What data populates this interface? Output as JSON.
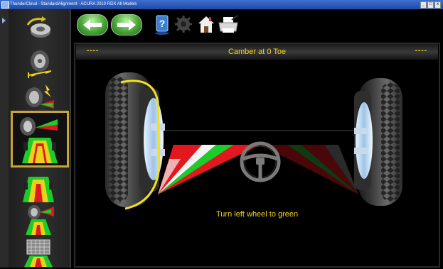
{
  "window": {
    "title": "ThunderCloud - StandardAlignment - ACURA 2010 RDX All Models",
    "buttons": [
      "_",
      "□",
      "x"
    ]
  },
  "toolbar": {
    "back_label": "back-arrow-icon",
    "forward_label": "forward-arrow-icon",
    "icons": [
      "help-book-icon",
      "settings-gear-icon",
      "home-icon",
      "print-icon"
    ]
  },
  "sidebar": {
    "items": [
      {
        "icon": "rotate-adapter-icon"
      },
      {
        "icon": "wheel-measure-icon"
      },
      {
        "icon": "camber-lightning-icon"
      },
      {
        "icon": "camber-at-zero-toe-icon",
        "selected": true
      },
      {
        "icon": "toe-yellow-icon"
      },
      {
        "icon": "wheel-adjust-icon"
      },
      {
        "icon": "grid-screen-icon"
      }
    ]
  },
  "main": {
    "title": "Camber at 0 Toe",
    "left_value": "----",
    "right_value": "----",
    "instruction": "Turn left wheel to green"
  },
  "colors": {
    "accent_yellow": "#f5d51a",
    "green": "#1bcc2a",
    "red": "#e3181e"
  }
}
